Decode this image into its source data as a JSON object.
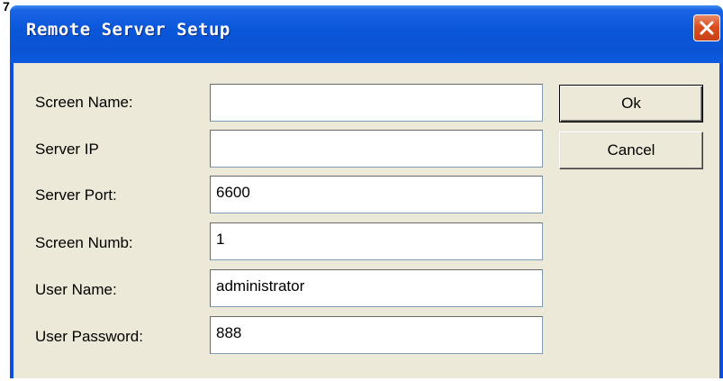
{
  "window": {
    "title": "Remote Server Setup",
    "background_glyph": "7"
  },
  "form": {
    "fields": [
      {
        "label": "Screen Name:",
        "value": ""
      },
      {
        "label": "Server IP",
        "value": ""
      },
      {
        "label": "Server Port:",
        "value": "6600"
      },
      {
        "label": "Screen Numb:",
        "value": "1"
      },
      {
        "label": "User Name:",
        "value": "administrator"
      },
      {
        "label": "User Password:",
        "value": "888"
      }
    ]
  },
  "buttons": {
    "ok_label": "Ok",
    "cancel_label": "Cancel"
  },
  "colors": {
    "titlebar": "#0a54d4",
    "client_bg": "#ece9d8",
    "close_button": "#d9501f"
  },
  "icons": {
    "close": "close-icon"
  }
}
